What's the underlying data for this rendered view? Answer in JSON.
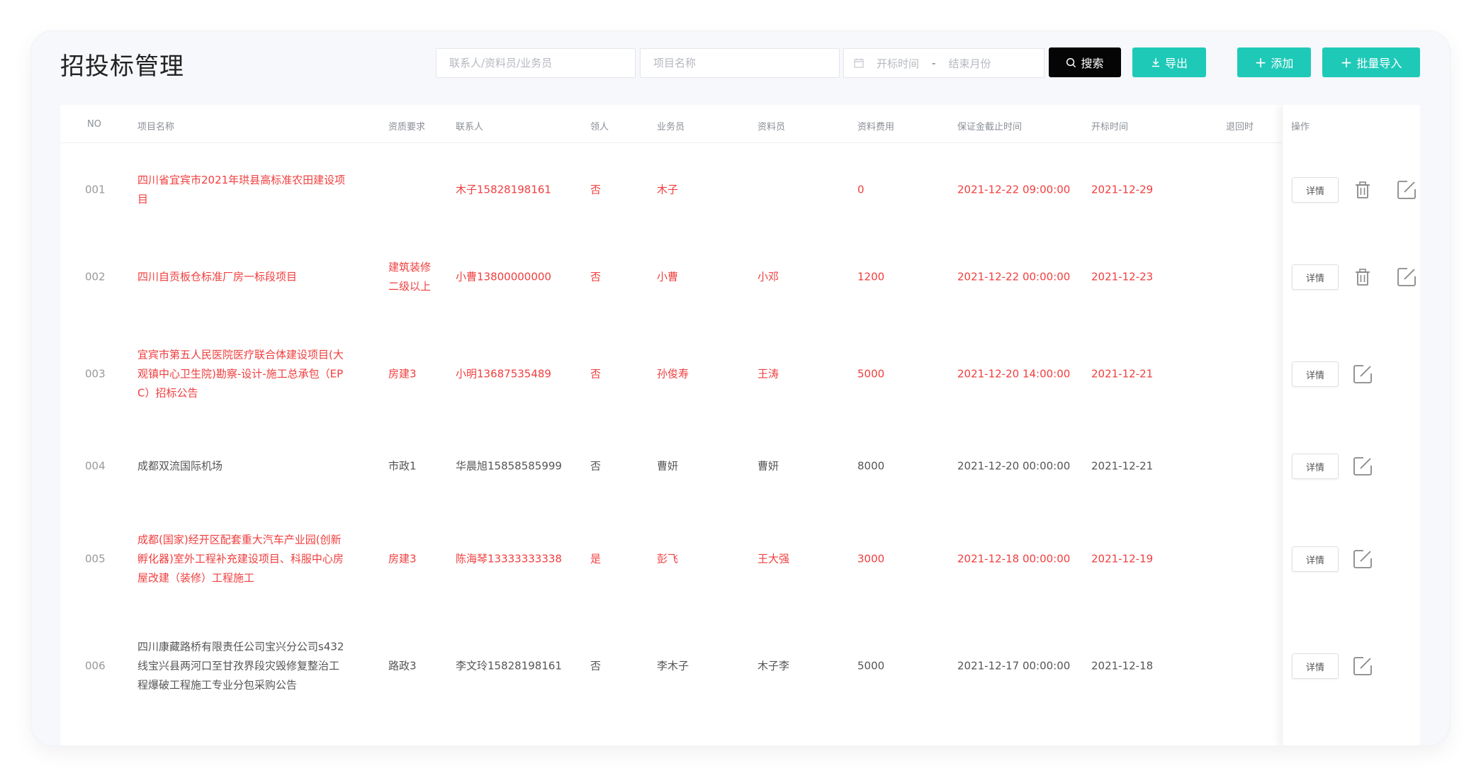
{
  "page_title": "招投标管理",
  "filters": {
    "contact_placeholder": "联系人/资料员/业务员",
    "project_placeholder": "项目名称",
    "date_start_placeholder": "开标时间",
    "date_separator": "-",
    "date_end_placeholder": "结束月份"
  },
  "buttons": {
    "search": "搜索",
    "export": "导出",
    "add": "添加",
    "batch_import": "批量导入"
  },
  "table": {
    "columns": {
      "no": "NO",
      "project": "项目名称",
      "qualification": "资质要求",
      "contact": "联系人",
      "claimed": "领人",
      "salesperson": "业务员",
      "data_clerk": "资料员",
      "data_fee": "资料费用",
      "deposit_deadline": "保证金截止时间",
      "bid_opening": "开标时间",
      "refund": "退回时",
      "actions": "操作"
    },
    "rows": [
      {
        "no": "001",
        "project_lines": [
          "四川省宜宾市2021年珙县高标准农田建设项",
          "目"
        ],
        "qualification_lines": [],
        "contact": "木子15828198161",
        "claimed": "否",
        "salesperson": "木子",
        "data_clerk": "",
        "data_fee": "0",
        "deposit_deadline": "2021-12-22 09:00:00",
        "bid_opening": "2021-12-29",
        "highlight": true,
        "detail_label": "详情",
        "has_delete": true
      },
      {
        "no": "002",
        "project_lines": [
          "四川自贡板仓标准厂房一标段项目"
        ],
        "qualification_lines": [
          "建筑装修",
          "二级以上"
        ],
        "contact": "小曹13800000000",
        "claimed": "否",
        "salesperson": "小曹",
        "data_clerk": "小邓",
        "data_fee": "1200",
        "deposit_deadline": "2021-12-22 00:00:00",
        "bid_opening": "2021-12-23",
        "highlight": true,
        "detail_label": "详情",
        "has_delete": true
      },
      {
        "no": "003",
        "project_lines": [
          "宜宾市第五人民医院医疗联合体建设项目(大",
          "观镇中心卫生院)勘察-设计-施工总承包（EP",
          "C）招标公告"
        ],
        "qualification_lines": [
          "房建3"
        ],
        "contact": "小明13687535489",
        "claimed": "否",
        "salesperson": "孙俊寿",
        "data_clerk": "王涛",
        "data_fee": "5000",
        "deposit_deadline": "2021-12-20 14:00:00",
        "bid_opening": "2021-12-21",
        "highlight": true,
        "detail_label": "详情",
        "has_delete": false
      },
      {
        "no": "004",
        "project_lines": [
          "成都双流国际机场"
        ],
        "qualification_lines": [
          "市政1"
        ],
        "contact": "华晨旭15858585999",
        "claimed": "否",
        "salesperson": "曹妍",
        "data_clerk": "曹妍",
        "data_fee": "8000",
        "deposit_deadline": "2021-12-20 00:00:00",
        "bid_opening": "2021-12-21",
        "highlight": false,
        "detail_label": "详情",
        "has_delete": false
      },
      {
        "no": "005",
        "project_lines": [
          "成都(国家)经开区配套重大汽车产业园(创新",
          "孵化器)室外工程补充建设项目、科服中心房",
          "屋改建（装修）工程施工"
        ],
        "qualification_lines": [
          "房建3"
        ],
        "contact": "陈海琴13333333338",
        "claimed": "是",
        "salesperson": "彭飞",
        "data_clerk": "王大强",
        "data_fee": "3000",
        "deposit_deadline": "2021-12-18 00:00:00",
        "bid_opening": "2021-12-19",
        "highlight": true,
        "detail_label": "详情",
        "has_delete": false
      },
      {
        "no": "006",
        "project_lines": [
          "四川康藏路桥有限责任公司宝兴分公司s432",
          "线宝兴县两河口至甘孜界段灾毁修复整治工",
          "程爆破工程施工专业分包采购公告"
        ],
        "qualification_lines": [
          "路政3"
        ],
        "contact": "李文玲15828198161",
        "claimed": "否",
        "salesperson": "李木子",
        "data_clerk": "木子李",
        "data_fee": "5000",
        "deposit_deadline": "2021-12-17 00:00:00",
        "bid_opening": "2021-12-18",
        "highlight": false,
        "detail_label": "详情",
        "has_delete": false
      }
    ]
  },
  "colors": {
    "accent": "#1fc9b8",
    "search_button": "#050505",
    "highlight_text": "#f03e3e"
  }
}
